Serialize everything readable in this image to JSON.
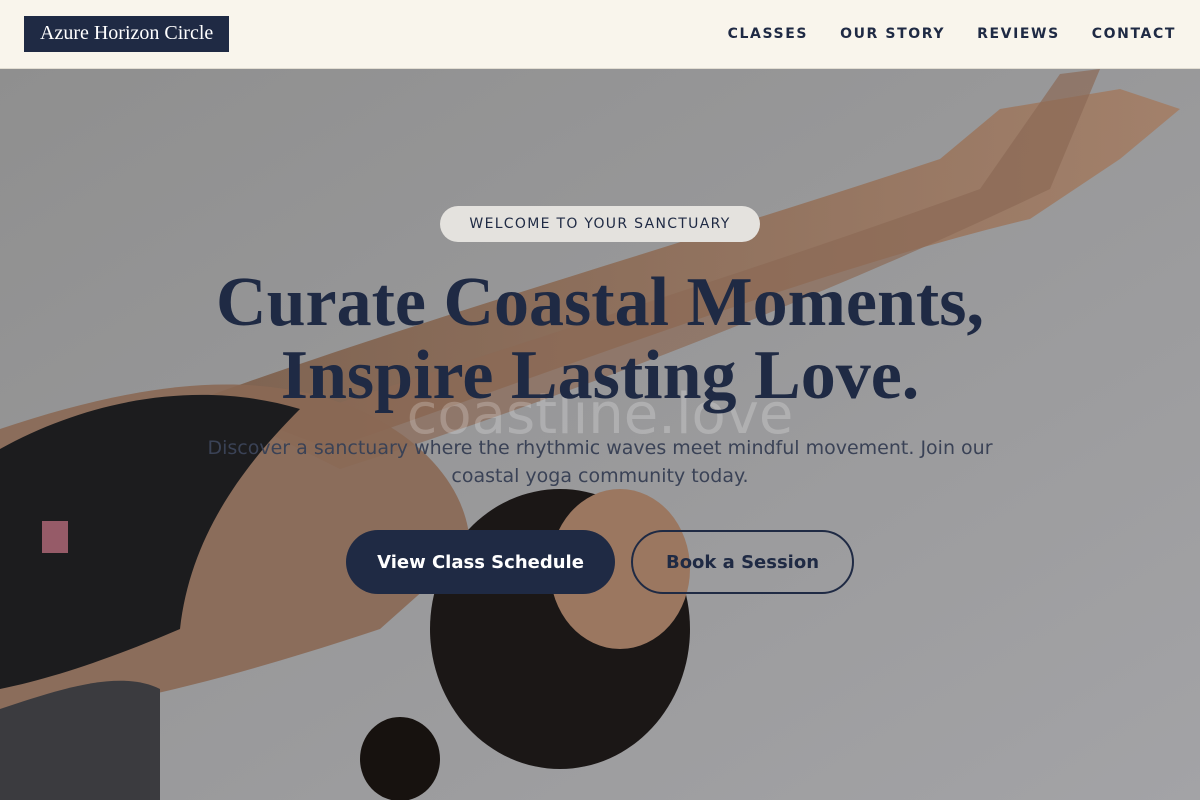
{
  "header": {
    "logo": "Azure Horizon Circle",
    "nav": [
      "CLASSES",
      "OUR STORY",
      "REVIEWS",
      "CONTACT"
    ]
  },
  "hero": {
    "eyebrow": "WELCOME TO YOUR SANCTUARY",
    "headline_line1": "Curate Coastal Moments,",
    "headline_line2": "Inspire Lasting Love.",
    "watermark": "coastline.love",
    "subtitle": "Discover a sanctuary where the rhythmic waves meet mindful movement. Join our coastal yoga community today.",
    "primary_button": "View Class Schedule",
    "secondary_button": "Book a Session"
  },
  "colors": {
    "navy": "#1f2a44",
    "header_bg": "#f9f5ec",
    "backdrop": "#9a9a9a"
  }
}
